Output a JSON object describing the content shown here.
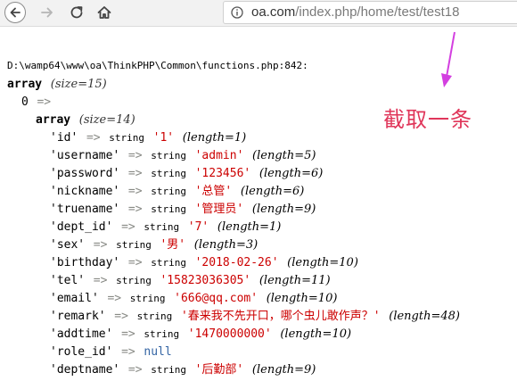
{
  "browser": {
    "url_domain": "oa.com",
    "url_path": "/index.php/home/test/test18"
  },
  "annotation": {
    "text": "截取一条",
    "color": "#e0365a"
  },
  "dump": {
    "file_path": "D:\\wamp64\\www\\oa\\ThinkPHP\\Common\\functions.php:842:",
    "outer_type": "array",
    "outer_size": "(size=15)",
    "index": "0",
    "arrow": "=>",
    "inner_type": "array",
    "inner_size": "(size=14)",
    "rows": [
      {
        "key": "'id'",
        "type": "string",
        "value": "'1'",
        "len": "(length=1)"
      },
      {
        "key": "'username'",
        "type": "string",
        "value": "'admin'",
        "len": "(length=5)"
      },
      {
        "key": "'password'",
        "type": "string",
        "value": "'123456'",
        "len": "(length=6)"
      },
      {
        "key": "'nickname'",
        "type": "string",
        "value": "'总管'",
        "len": "(length=6)"
      },
      {
        "key": "'truename'",
        "type": "string",
        "value": "'管理员'",
        "len": "(length=9)"
      },
      {
        "key": "'dept_id'",
        "type": "string",
        "value": "'7'",
        "len": "(length=1)"
      },
      {
        "key": "'sex'",
        "type": "string",
        "value": "'男'",
        "len": "(length=3)"
      },
      {
        "key": "'birthday'",
        "type": "string",
        "value": "'2018-02-26'",
        "len": "(length=10)"
      },
      {
        "key": "'tel'",
        "type": "string",
        "value": "'15823036305'",
        "len": "(length=11)"
      },
      {
        "key": "'email'",
        "type": "string",
        "value": "'666@qq.com'",
        "len": "(length=10)"
      },
      {
        "key": "'remark'",
        "type": "string",
        "value": "'春来我不先开口，哪个虫儿敢作声？'",
        "len": "(length=48)"
      },
      {
        "key": "'addtime'",
        "type": "string",
        "value": "'1470000000'",
        "len": "(length=10)"
      },
      {
        "key": "'role_id'",
        "type": "",
        "value": "null",
        "len": ""
      },
      {
        "key": "'deptname'",
        "type": "string",
        "value": "'后勤部'",
        "len": "(length=9)"
      }
    ]
  }
}
